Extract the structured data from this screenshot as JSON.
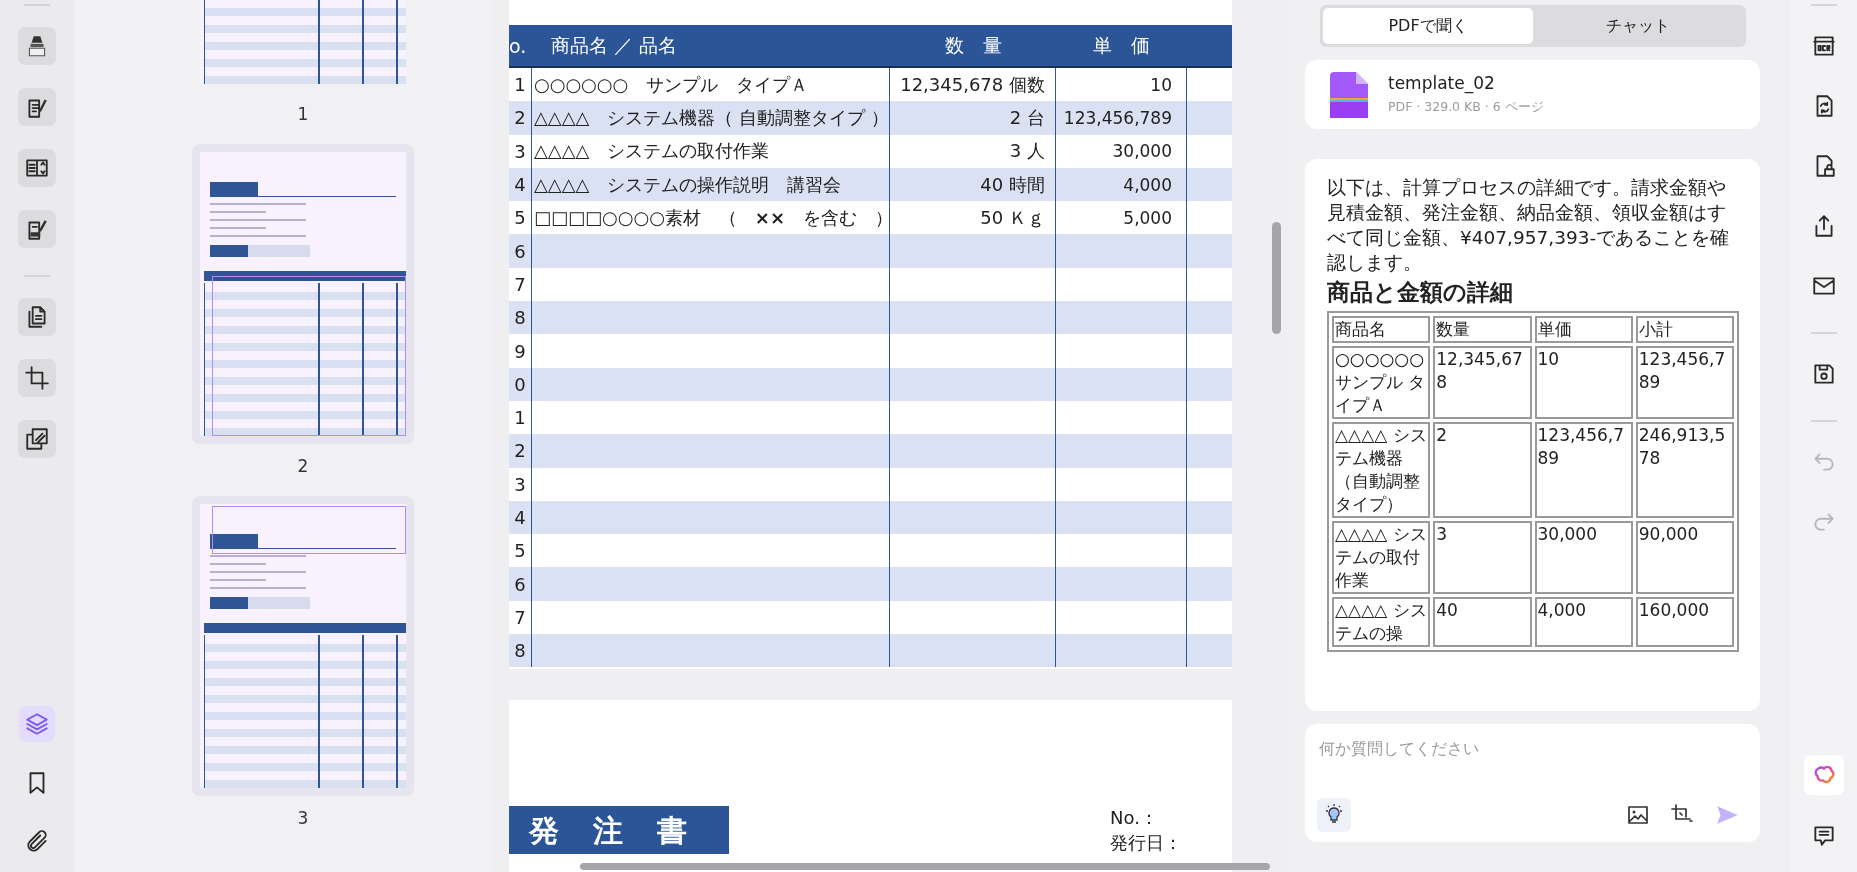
{
  "left_toolbar": {
    "groups": [
      [
        {
          "kind": "highlighter",
          "selected": false
        },
        {
          "kind": "note-edit",
          "selected": false
        },
        {
          "kind": "form",
          "selected": false
        },
        {
          "kind": "sign",
          "selected": false
        }
      ],
      [
        {
          "kind": "pages",
          "selected": false
        },
        {
          "kind": "crop",
          "selected": false
        },
        {
          "kind": "overlay",
          "selected": false
        }
      ]
    ],
    "bottom": [
      {
        "kind": "layers",
        "selected": true
      },
      {
        "kind": "bookmark",
        "selected": false
      },
      {
        "kind": "attachment",
        "selected": false
      }
    ]
  },
  "thumbnails": [
    {
      "label": "1",
      "in_view": false,
      "cropped_top": true
    },
    {
      "label": "2",
      "in_view": true,
      "cropped_top": false
    },
    {
      "label": "3",
      "in_view": true,
      "cropped_top": false
    }
  ],
  "document": {
    "table": {
      "columns": [
        "o.",
        "商品名 ／ 品名",
        "数　量",
        "単　価"
      ],
      "rows": [
        {
          "no": "1",
          "name": "○○○○○○　サンプル　タイプＡ",
          "quantity": "12,345,678 個数",
          "unit_price": "10"
        },
        {
          "no": "2",
          "name": "△△△△　システム機器（ 自動調整タイプ ）",
          "quantity": "2 台",
          "unit_price": "123,456,789"
        },
        {
          "no": "3",
          "name": "△△△△　システムの取付作業",
          "quantity": "3 人",
          "unit_price": "30,000"
        },
        {
          "no": "4",
          "name": "△△△△　システムの操作説明　講習会",
          "quantity": "40 時間",
          "unit_price": "4,000"
        },
        {
          "no": "5",
          "name": "□□□□○○○○素材　（　**××**　を含む　）",
          "quantity": "50 Ｋｇ",
          "unit_price": "5,000"
        },
        {
          "no": "6"
        },
        {
          "no": "7"
        },
        {
          "no": "8"
        },
        {
          "no": "9"
        },
        {
          "no": "0"
        },
        {
          "no": "1"
        },
        {
          "no": "2"
        },
        {
          "no": "3"
        },
        {
          "no": "4"
        },
        {
          "no": "5"
        },
        {
          "no": "6"
        },
        {
          "no": "7"
        },
        {
          "no": "8"
        }
      ]
    },
    "next_page": {
      "title": "発　注　書",
      "number_label": "No.：",
      "date_label": "発行日："
    }
  },
  "assistant_panel": {
    "tabs": [
      {
        "label": "PDFで聞く",
        "selected": true
      },
      {
        "label": "チャット",
        "selected": false
      }
    ],
    "file": {
      "name": "template_02",
      "meta": "PDF · 329.0 KB · 6 ページ"
    },
    "message": {
      "text": "以下は、計算プロセスの詳細です。請求金額や見積金額、発注金額、納品金額、領収金額はすべて同じ金額、¥407,957,393-であることを確認します。",
      "heading": "商品と金額の詳細",
      "table": {
        "columns": [
          "商品名",
          "数量",
          "単価",
          "小計"
        ],
        "rows": [
          [
            "○○○○○○ サンプル タイプＡ",
            "12,345,678",
            "10",
            "123,456,789"
          ],
          [
            "△△△△ システム機器（自動調整タイプ）",
            "2",
            "123,456,789",
            "246,913,578"
          ],
          [
            "△△△△ システムの取付作業",
            "3",
            "30,000",
            "90,000"
          ],
          [
            "△△△△ システムの操",
            "40",
            "4,000",
            "160,000"
          ]
        ]
      }
    },
    "input": {
      "placeholder": "何か質問してください"
    }
  },
  "right_toolbar": {
    "groups": [
      [
        {
          "kind": "ocr",
          "disabled": false
        },
        {
          "kind": "convert",
          "disabled": false
        },
        {
          "kind": "protect",
          "disabled": false
        },
        {
          "kind": "share",
          "disabled": false
        },
        {
          "kind": "mail",
          "disabled": false
        }
      ],
      [
        {
          "kind": "save",
          "disabled": false
        }
      ],
      [
        {
          "kind": "undo",
          "disabled": true
        },
        {
          "kind": "redo",
          "disabled": true
        }
      ]
    ],
    "bottom": [
      {
        "kind": "ai-assistant"
      },
      {
        "kind": "comment"
      }
    ]
  }
}
